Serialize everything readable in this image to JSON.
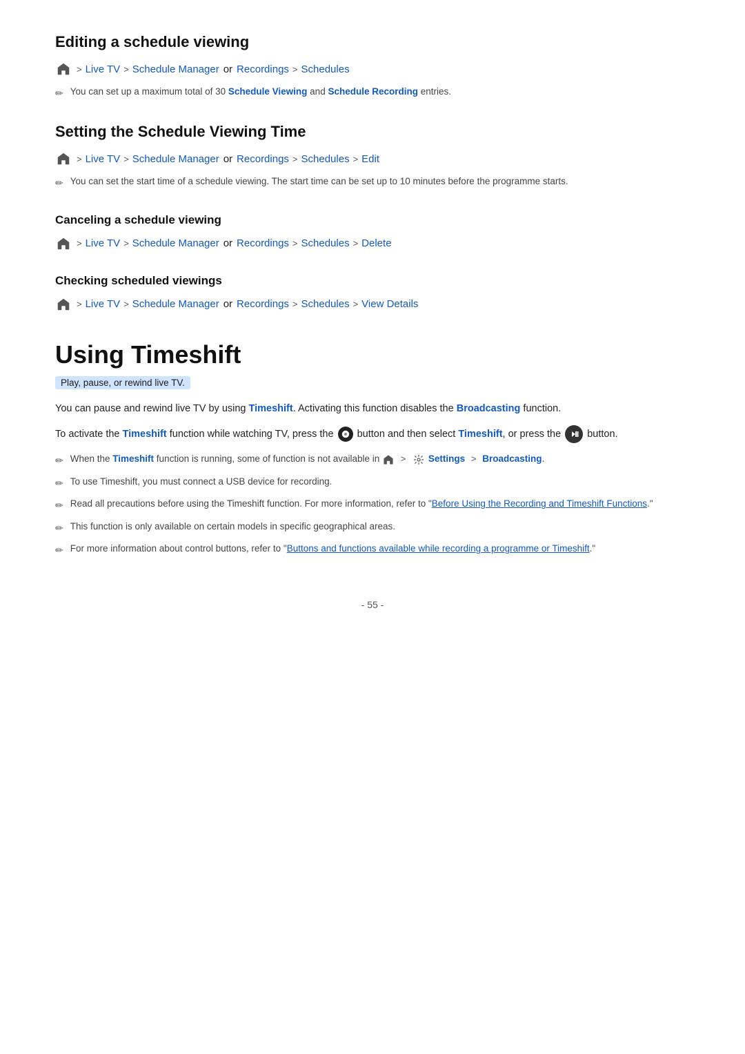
{
  "sections": [
    {
      "id": "editing-schedule",
      "heading": "Editing a schedule viewing",
      "nav": {
        "items": [
          "Live TV",
          "Schedule Manager",
          "or Recordings",
          "Schedules"
        ],
        "links": [
          true,
          true,
          false,
          true
        ]
      },
      "notes": [
        "You can set up a maximum total of 30 Schedule Viewing and Schedule Recording entries."
      ]
    },
    {
      "id": "setting-schedule-time",
      "heading": "Setting the Schedule Viewing Time",
      "nav": {
        "items": [
          "Live TV",
          "Schedule Manager",
          "or Recordings",
          "Schedules",
          "Edit"
        ],
        "links": [
          true,
          true,
          false,
          true,
          true
        ]
      },
      "notes": [
        "You can set the start time of a schedule viewing. The start time can be set up to 10 minutes before the programme starts."
      ]
    },
    {
      "id": "canceling-schedule",
      "heading": "Canceling a schedule viewing",
      "nav": {
        "items": [
          "Live TV",
          "Schedule Manager",
          "or Recordings",
          "Schedules",
          "Delete"
        ],
        "links": [
          true,
          true,
          false,
          true,
          true
        ]
      },
      "notes": []
    },
    {
      "id": "checking-schedule",
      "heading": "Checking scheduled viewings",
      "nav": {
        "items": [
          "Live TV",
          "Schedule Manager",
          "or Recordings",
          "Schedules",
          "View Details"
        ],
        "links": [
          true,
          true,
          false,
          true,
          true
        ]
      },
      "notes": []
    }
  ],
  "timeshift": {
    "heading": "Using Timeshift",
    "subtitle": "Play, pause, or rewind live TV.",
    "body1": "You can pause and rewind live TV by using Timeshift. Activating this function disables the Broadcasting function.",
    "body2": "To activate the Timeshift function while watching TV, press the  button and then select Timeshift, or press the  button.",
    "bullets": [
      "When the Timeshift function is running, some of function is not available in  >  Settings > Broadcasting.",
      "To use Timeshift, you must connect a USB device for recording.",
      "Read all precautions before using the Timeshift function. For more information, refer to \"Before Using the Recording and Timeshift Functions.\"",
      "This function is only available on certain models in specific geographical areas.",
      "For more information about control buttons, refer to \"Buttons and functions available while recording a programme or Timeshift.\""
    ]
  },
  "page_number": "- 55 -"
}
